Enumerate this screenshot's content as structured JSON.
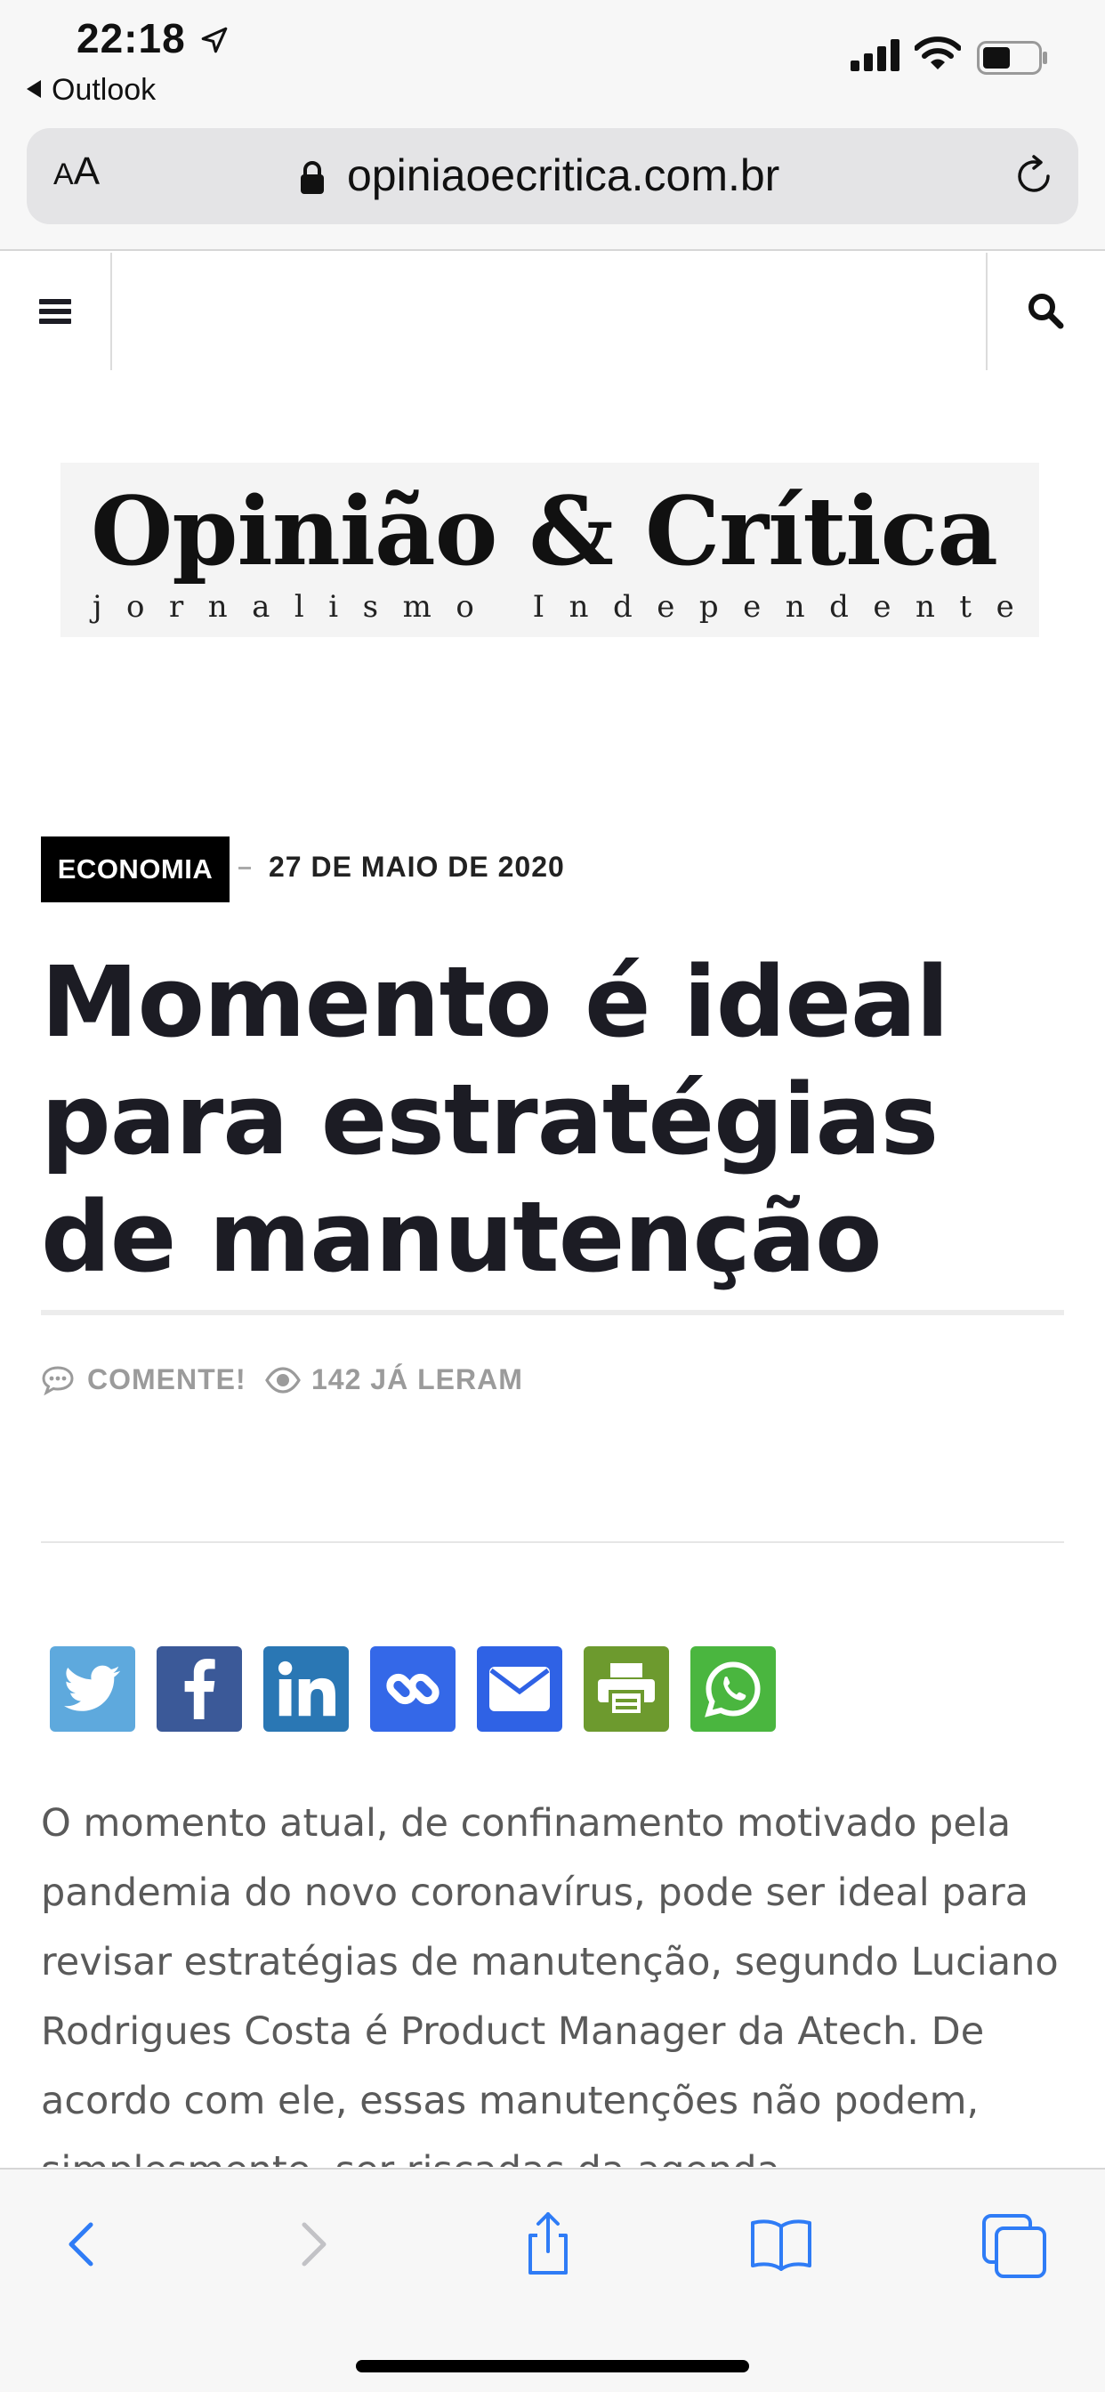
{
  "status_bar": {
    "time": "22:18",
    "back_app": "Outlook"
  },
  "browser": {
    "text_size_button_small": "A",
    "text_size_button_large": "A",
    "url": "opiniaoecritica.com.br"
  },
  "site": {
    "logo_title": "Opinião & Crítica",
    "logo_subtitle": "jornalismo Independente"
  },
  "article": {
    "category": "ECONOMIA",
    "date": "27 DE MAIO DE 2020",
    "title": "Momento é ideal para estratégias de manutenção",
    "comments_label": "COMENTE!",
    "views_label": "142 JÁ LERAM",
    "body": "O momento atual, de confinamento motivado pela pandemia do novo coronavírus, pode ser ideal para revisar estratégias de manutenção, segundo Luciano Rodrigues Costa é Product Manager da Atech. De acordo com ele, essas manutenções não podem, simplesmente, ser riscadas da agenda."
  },
  "share_buttons": [
    {
      "name": "twitter",
      "icon": "twitter-icon",
      "color": "#5ea9dd"
    },
    {
      "name": "facebook",
      "icon": "facebook-icon",
      "color": "#3b5998"
    },
    {
      "name": "linkedin",
      "icon": "linkedin-icon",
      "color": "#2a77b4"
    },
    {
      "name": "copy-link",
      "icon": "link-icon",
      "color": "#3468e8"
    },
    {
      "name": "email",
      "icon": "mail-icon",
      "color": "#2f62e5"
    },
    {
      "name": "print",
      "icon": "printer-icon",
      "color": "#6d9a2e"
    },
    {
      "name": "whatsapp",
      "icon": "whatsapp-icon",
      "color": "#4ab63f"
    }
  ],
  "colors": {
    "badge_bg": "#000000",
    "title": "#1c1c24",
    "muted": "#9b9b9b",
    "body_text": "#5a5a5a",
    "ios_blue": "#2f7cf6"
  }
}
